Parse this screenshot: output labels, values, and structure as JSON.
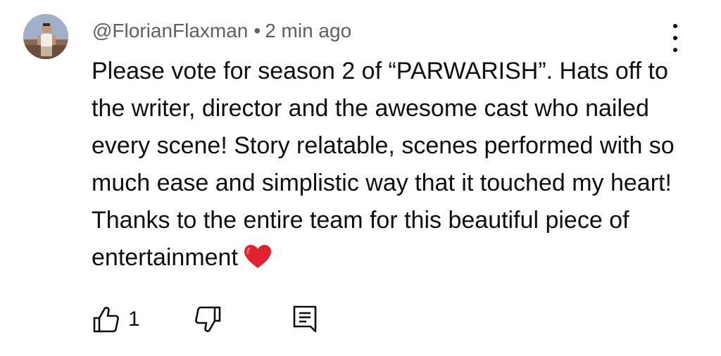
{
  "comment": {
    "author": "@FlorianFlaxman",
    "separator": "•",
    "time": "2 min ago",
    "text": "Please vote for season 2 of “PARWARISH”. Hats off to the writer, director and the awesome cast who nailed every scene! Story relatable, scenes performed with so much ease and simplistic way that it touched my heart! Thanks to the entire team for this beautiful piece of entertainment",
    "emoji": "heart-emoji",
    "like_count": "1"
  },
  "icons": {
    "menu": "more-vertical-icon",
    "like": "thumbs-up-icon",
    "dislike": "thumbs-down-icon",
    "reply": "reply-comment-icon"
  },
  "colors": {
    "text": "#0f0f0f",
    "meta": "#606060",
    "heart": "#e0232e"
  }
}
